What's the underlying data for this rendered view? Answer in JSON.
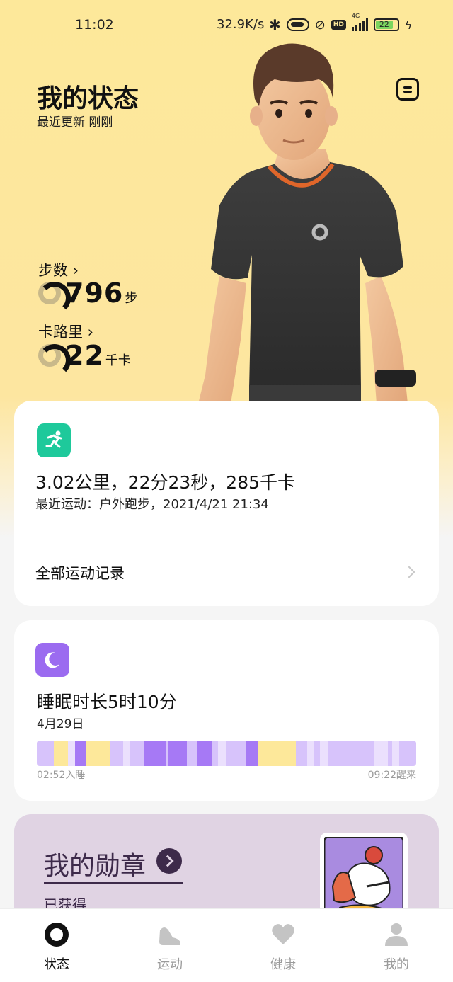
{
  "status_bar": {
    "time": "11:02",
    "net_speed": "32.9K/s",
    "network": "4G",
    "battery": "22"
  },
  "header": {
    "title": "我的状态",
    "subtitle": "最近更新 刚刚",
    "report_icon": "document-icon"
  },
  "metrics": {
    "steps": {
      "label": "步数",
      "value": "796",
      "unit": "步"
    },
    "calories": {
      "label": "卡路里",
      "value": "22",
      "unit": "千卡"
    }
  },
  "exercise_card": {
    "icon": "running-icon",
    "summary": "3.02公里，22分23秒，285千卡",
    "recent": "最近运动：户外跑步，2021/4/21  21:34",
    "all_records": "全部运动记录",
    "accent": "#1ec99b"
  },
  "sleep_card": {
    "icon": "moon-icon",
    "title": "睡眠时长5时10分",
    "date": "4月29日",
    "start_label": "02:52入睡",
    "end_label": "09:22醒来",
    "accent": "#9b6bf0",
    "colors": {
      "deep": "#a679f5",
      "light": "#d7c3fb",
      "rem": "#ebe0fd",
      "awake": "#fde89a"
    }
  },
  "badge_card": {
    "title": "我的勋章",
    "subtitle": "已获得",
    "background": "#e0d3e3"
  },
  "tabs": [
    {
      "label": "状态",
      "icon": "status-ring-icon",
      "active": true
    },
    {
      "label": "运动",
      "icon": "shoe-icon",
      "active": false
    },
    {
      "label": "健康",
      "icon": "heart-icon",
      "active": false
    },
    {
      "label": "我的",
      "icon": "person-icon",
      "active": false
    }
  ]
}
